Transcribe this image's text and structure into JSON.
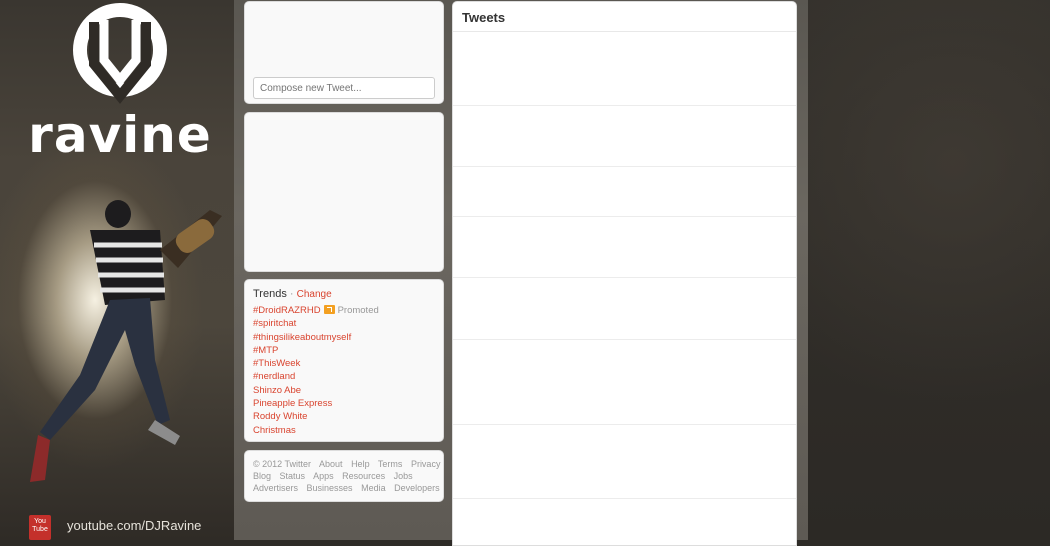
{
  "background": {
    "brand": "ravine",
    "youtube_icon_text": "You Tube",
    "youtube_link": "youtube.com/DJRavine"
  },
  "compose": {
    "placeholder": "Compose new Tweet..."
  },
  "trends": {
    "title": "Trends",
    "separator": "·",
    "change_label": "Change",
    "items": [
      {
        "label": "#DroidRAZRHD",
        "promoted": "Promoted"
      },
      {
        "label": "#spiritchat"
      },
      {
        "label": "#thingsilikeaboutmyself"
      },
      {
        "label": "#MTP"
      },
      {
        "label": "#ThisWeek"
      },
      {
        "label": "#nerdland"
      },
      {
        "label": "Shinzo Abe"
      },
      {
        "label": "Pineapple Express"
      },
      {
        "label": "Roddy White"
      },
      {
        "label": "Christmas"
      }
    ]
  },
  "footer": {
    "rows": [
      [
        "© 2012 Twitter",
        "About",
        "Help",
        "Terms",
        "Privacy"
      ],
      [
        "Blog",
        "Status",
        "Apps",
        "Resources",
        "Jobs"
      ],
      [
        "Advertisers",
        "Businesses",
        "Media",
        "Developers"
      ]
    ]
  },
  "timeline": {
    "title": "Tweets"
  },
  "colors": {
    "link": "#d9442f",
    "youtube": "#c4302b",
    "promoted": "#f3a021"
  }
}
